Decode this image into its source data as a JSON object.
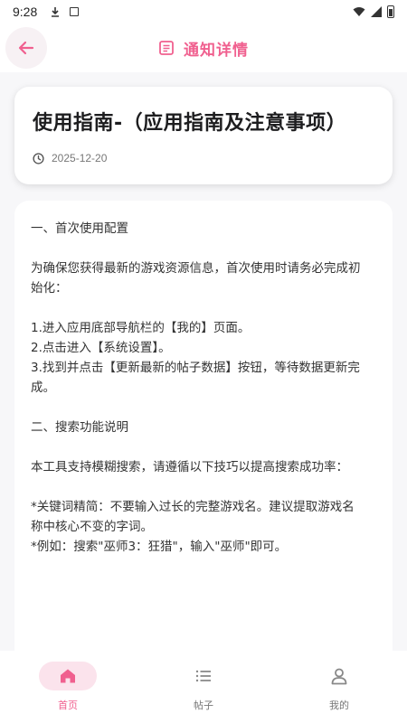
{
  "status_bar": {
    "time": "9:28"
  },
  "header": {
    "title": "通知详情",
    "accent_color": "#f0608f"
  },
  "notice": {
    "title": "使用指南-（应用指南及注意事项）",
    "date": "2025-12-20",
    "lines": [
      "一、首次使用配置",
      "",
      "为确保您获得最新的游戏资源信息，首次使用时请务必完成初",
      "始化：",
      "",
      "1.进入应用底部导航栏的【我的】页面。",
      "2.点击进入【系统设置】。",
      "3.找到并点击【更新最新的帖子数据】按钮，等待数据更新完",
      "成。",
      "",
      "二、搜索功能说明",
      "",
      "本工具支持模糊搜索，请遵循以下技巧以提高搜索成功率：",
      "",
      "*关键词精简：不要输入过长的完整游戏名。建议提取游戏名",
      "称中核心不变的字词。",
      "*例如：搜索\"巫师3：狂猎\"，输入\"巫师\"即可。"
    ]
  },
  "bottom_nav": {
    "items": [
      {
        "label": "首页",
        "icon": "home-icon",
        "active": true
      },
      {
        "label": "帖子",
        "icon": "list-icon",
        "active": false
      },
      {
        "label": "我的",
        "icon": "profile-icon",
        "active": false
      }
    ]
  }
}
